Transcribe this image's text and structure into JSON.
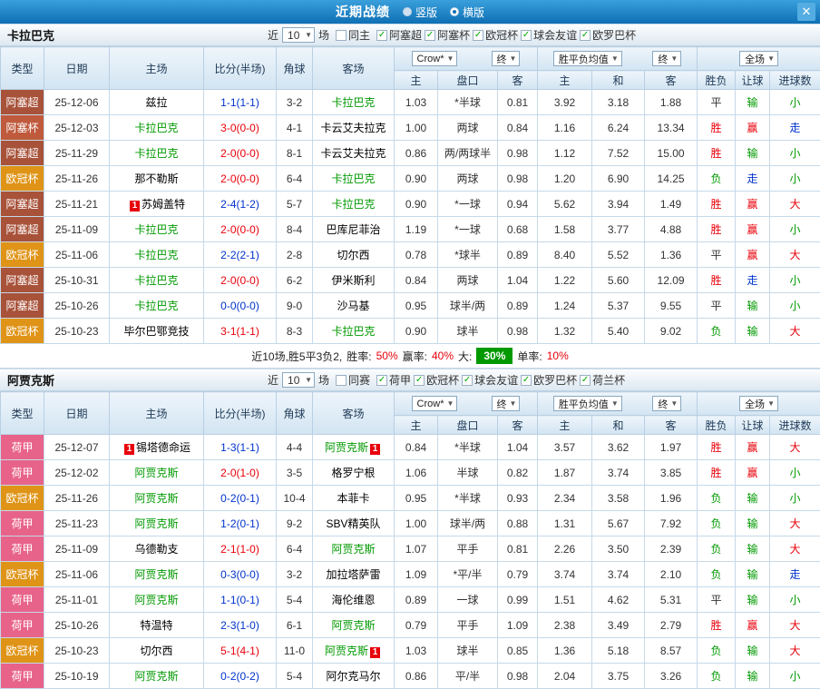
{
  "topbar": {
    "title": "近期战绩",
    "radios": [
      {
        "label": "竖版",
        "selected": false
      },
      {
        "label": "横版",
        "selected": true
      }
    ],
    "close_icon": "✕"
  },
  "palette": {
    "red": "#e8000a",
    "green": "#009900",
    "blue": "#0033cc",
    "black": "#333333",
    "topbar_blue": "#0e6fb4",
    "badge_red": "#e8000a",
    "summary_badge_green": "#009900"
  },
  "league_colors": {
    "阿塞超": "#a8523a",
    "阿塞杯": "#bf5a3d",
    "欧冠杯": "#df9417",
    "荷甲": "#e8638a"
  },
  "columns": {
    "type": "类型",
    "date": "日期",
    "home": "主场",
    "score": "比分(半场)",
    "corner": "角球",
    "away": "客场",
    "asia_home": "主",
    "handicap": "盘口",
    "asia_away": "客",
    "euro_home": "主",
    "euro_draw": "和",
    "euro_away": "客",
    "result": "胜负",
    "cover": "让球",
    "goals": "进球数"
  },
  "sections": [
    {
      "team": "卡拉巴克",
      "filters": {
        "near": "近",
        "count": "10",
        "games": "场",
        "same": "同主",
        "same_checked": false,
        "leagues": [
          {
            "label": "阿塞超",
            "checked": true
          },
          {
            "label": "阿塞杯",
            "checked": true
          },
          {
            "label": "欧冠杯",
            "checked": true
          },
          {
            "label": "球会友谊",
            "checked": true
          },
          {
            "label": "欧罗巴杯",
            "checked": true
          }
        ]
      },
      "dropdowns": {
        "bk": "Crow*",
        "fin1": "终",
        "avg": "胜平负均值",
        "fin2": "终",
        "scope": "全场"
      },
      "rows": [
        {
          "type": "阿塞超",
          "date": "25-12-06",
          "home": "兹拉",
          "home_focal": false,
          "home_badge": "",
          "score": "1-1(1-1)",
          "score_color": "blue",
          "corner": "3-2",
          "away": "卡拉巴克",
          "away_focal": true,
          "away_badge": "",
          "asia": [
            "1.03",
            "*半球",
            "0.81"
          ],
          "euro": [
            "3.92",
            "3.18",
            "1.88"
          ],
          "result": "平",
          "result_color": "black",
          "cover": "输",
          "cover_color": "green",
          "goals": "小",
          "goals_color": "green"
        },
        {
          "type": "阿塞杯",
          "date": "25-12-03",
          "home": "卡拉巴克",
          "home_focal": true,
          "home_badge": "",
          "score": "3-0(0-0)",
          "score_color": "red",
          "corner": "4-1",
          "away": "卡云艾夫拉克",
          "away_focal": false,
          "away_badge": "",
          "asia": [
            "1.00",
            "两球",
            "0.84"
          ],
          "euro": [
            "1.16",
            "6.24",
            "13.34"
          ],
          "result": "胜",
          "result_color": "red",
          "cover": "赢",
          "cover_color": "red",
          "goals": "走",
          "goals_color": "blue"
        },
        {
          "type": "阿塞超",
          "date": "25-11-29",
          "home": "卡拉巴克",
          "home_focal": true,
          "home_badge": "",
          "score": "2-0(0-0)",
          "score_color": "red",
          "corner": "8-1",
          "away": "卡云艾夫拉克",
          "away_focal": false,
          "away_badge": "",
          "asia": [
            "0.86",
            "两/两球半",
            "0.98"
          ],
          "euro": [
            "1.12",
            "7.52",
            "15.00"
          ],
          "result": "胜",
          "result_color": "red",
          "cover": "输",
          "cover_color": "green",
          "goals": "小",
          "goals_color": "green"
        },
        {
          "type": "欧冠杯",
          "date": "25-11-26",
          "home": "那不勒斯",
          "home_focal": false,
          "home_badge": "",
          "score": "2-0(0-0)",
          "score_color": "red",
          "corner": "6-4",
          "away": "卡拉巴克",
          "away_focal": true,
          "away_badge": "",
          "asia": [
            "0.90",
            "两球",
            "0.98"
          ],
          "euro": [
            "1.20",
            "6.90",
            "14.25"
          ],
          "result": "负",
          "result_color": "green",
          "cover": "走",
          "cover_color": "blue",
          "goals": "小",
          "goals_color": "green"
        },
        {
          "type": "阿塞超",
          "date": "25-11-21",
          "home": "苏姆盖特",
          "home_focal": false,
          "home_badge": "1",
          "score": "2-4(1-2)",
          "score_color": "blue",
          "corner": "5-7",
          "away": "卡拉巴克",
          "away_focal": true,
          "away_badge": "",
          "asia": [
            "0.90",
            "*一球",
            "0.94"
          ],
          "euro": [
            "5.62",
            "3.94",
            "1.49"
          ],
          "result": "胜",
          "result_color": "red",
          "cover": "赢",
          "cover_color": "red",
          "goals": "大",
          "goals_color": "red"
        },
        {
          "type": "阿塞超",
          "date": "25-11-09",
          "home": "卡拉巴克",
          "home_focal": true,
          "home_badge": "",
          "score": "2-0(0-0)",
          "score_color": "red",
          "corner": "8-4",
          "away": "巴库尼菲治",
          "away_focal": false,
          "away_badge": "",
          "asia": [
            "1.19",
            "*一球",
            "0.68"
          ],
          "euro": [
            "1.58",
            "3.77",
            "4.88"
          ],
          "result": "胜",
          "result_color": "red",
          "cover": "赢",
          "cover_color": "red",
          "goals": "小",
          "goals_color": "green"
        },
        {
          "type": "欧冠杯",
          "date": "25-11-06",
          "home": "卡拉巴克",
          "home_focal": true,
          "home_badge": "",
          "score": "2-2(2-1)",
          "score_color": "blue",
          "corner": "2-8",
          "away": "切尔西",
          "away_focal": false,
          "away_badge": "",
          "asia": [
            "0.78",
            "*球半",
            "0.89"
          ],
          "euro": [
            "8.40",
            "5.52",
            "1.36"
          ],
          "result": "平",
          "result_color": "black",
          "cover": "赢",
          "cover_color": "red",
          "goals": "大",
          "goals_color": "red"
        },
        {
          "type": "阿塞超",
          "date": "25-10-31",
          "home": "卡拉巴克",
          "home_focal": true,
          "home_badge": "",
          "score": "2-0(0-0)",
          "score_color": "red",
          "corner": "6-2",
          "away": "伊米斯利",
          "away_focal": false,
          "away_badge": "",
          "asia": [
            "0.84",
            "两球",
            "1.04"
          ],
          "euro": [
            "1.22",
            "5.60",
            "12.09"
          ],
          "result": "胜",
          "result_color": "red",
          "cover": "走",
          "cover_color": "blue",
          "goals": "小",
          "goals_color": "green"
        },
        {
          "type": "阿塞超",
          "date": "25-10-26",
          "home": "卡拉巴克",
          "home_focal": true,
          "home_badge": "",
          "score": "0-0(0-0)",
          "score_color": "blue",
          "corner": "9-0",
          "away": "沙马基",
          "away_focal": false,
          "away_badge": "",
          "asia": [
            "0.95",
            "球半/两",
            "0.89"
          ],
          "euro": [
            "1.24",
            "5.37",
            "9.55"
          ],
          "result": "平",
          "result_color": "black",
          "cover": "输",
          "cover_color": "green",
          "goals": "小",
          "goals_color": "green"
        },
        {
          "type": "欧冠杯",
          "date": "25-10-23",
          "home": "毕尔巴鄂竞技",
          "home_focal": false,
          "home_badge": "",
          "score": "3-1(1-1)",
          "score_color": "red",
          "corner": "8-3",
          "away": "卡拉巴克",
          "away_focal": true,
          "away_badge": "",
          "asia": [
            "0.90",
            "球半",
            "0.98"
          ],
          "euro": [
            "1.32",
            "5.40",
            "9.02"
          ],
          "result": "负",
          "result_color": "green",
          "cover": "输",
          "cover_color": "green",
          "goals": "大",
          "goals_color": "red"
        }
      ],
      "summary": {
        "lead": "近10场,胜5平3负2,",
        "win_label": "胜率:",
        "win": "50%",
        "cover_label": "赢率:",
        "cover": "40%",
        "big_label": "大:",
        "big": "30%",
        "odd_label": "单率:",
        "odd": "10%"
      }
    },
    {
      "team": "阿贾克斯",
      "filters": {
        "near": "近",
        "count": "10",
        "games": "场",
        "same": "同赛",
        "same_checked": false,
        "leagues": [
          {
            "label": "荷甲",
            "checked": true
          },
          {
            "label": "欧冠杯",
            "checked": true
          },
          {
            "label": "球会友谊",
            "checked": true
          },
          {
            "label": "欧罗巴杯",
            "checked": true
          },
          {
            "label": "荷兰杯",
            "checked": true
          }
        ]
      },
      "dropdowns": {
        "bk": "Crow*",
        "fin1": "终",
        "avg": "胜平负均值",
        "fin2": "终",
        "scope": "全场"
      },
      "rows": [
        {
          "type": "荷甲",
          "date": "25-12-07",
          "home": "锡塔德命运",
          "home_focal": false,
          "home_badge": "1",
          "score": "1-3(1-1)",
          "score_color": "blue",
          "corner": "4-4",
          "away": "阿贾克斯",
          "away_focal": true,
          "away_badge": "1",
          "asia": [
            "0.84",
            "*半球",
            "1.04"
          ],
          "euro": [
            "3.57",
            "3.62",
            "1.97"
          ],
          "result": "胜",
          "result_color": "red",
          "cover": "赢",
          "cover_color": "red",
          "goals": "大",
          "goals_color": "red"
        },
        {
          "type": "荷甲",
          "date": "25-12-02",
          "home": "阿贾克斯",
          "home_focal": true,
          "home_badge": "",
          "score": "2-0(1-0)",
          "score_color": "red",
          "corner": "3-5",
          "away": "格罗宁根",
          "away_focal": false,
          "away_badge": "",
          "asia": [
            "1.06",
            "半球",
            "0.82"
          ],
          "euro": [
            "1.87",
            "3.74",
            "3.85"
          ],
          "result": "胜",
          "result_color": "red",
          "cover": "赢",
          "cover_color": "red",
          "goals": "小",
          "goals_color": "green"
        },
        {
          "type": "欧冠杯",
          "date": "25-11-26",
          "home": "阿贾克斯",
          "home_focal": true,
          "home_badge": "",
          "score": "0-2(0-1)",
          "score_color": "blue",
          "corner": "10-4",
          "away": "本菲卡",
          "away_focal": false,
          "away_badge": "",
          "asia": [
            "0.95",
            "*半球",
            "0.93"
          ],
          "euro": [
            "2.34",
            "3.58",
            "1.96"
          ],
          "result": "负",
          "result_color": "green",
          "cover": "输",
          "cover_color": "green",
          "goals": "小",
          "goals_color": "green"
        },
        {
          "type": "荷甲",
          "date": "25-11-23",
          "home": "阿贾克斯",
          "home_focal": true,
          "home_badge": "",
          "score": "1-2(0-1)",
          "score_color": "blue",
          "corner": "9-2",
          "away": "SBV精英队",
          "away_focal": false,
          "away_badge": "",
          "asia": [
            "1.00",
            "球半/两",
            "0.88"
          ],
          "euro": [
            "1.31",
            "5.67",
            "7.92"
          ],
          "result": "负",
          "result_color": "green",
          "cover": "输",
          "cover_color": "green",
          "goals": "大",
          "goals_color": "red"
        },
        {
          "type": "荷甲",
          "date": "25-11-09",
          "home": "乌德勒支",
          "home_focal": false,
          "home_badge": "",
          "score": "2-1(1-0)",
          "score_color": "red",
          "corner": "6-4",
          "away": "阿贾克斯",
          "away_focal": true,
          "away_badge": "",
          "asia": [
            "1.07",
            "平手",
            "0.81"
          ],
          "euro": [
            "2.26",
            "3.50",
            "2.39"
          ],
          "result": "负",
          "result_color": "green",
          "cover": "输",
          "cover_color": "green",
          "goals": "大",
          "goals_color": "red"
        },
        {
          "type": "欧冠杯",
          "date": "25-11-06",
          "home": "阿贾克斯",
          "home_focal": true,
          "home_badge": "",
          "score": "0-3(0-0)",
          "score_color": "blue",
          "corner": "3-2",
          "away": "加拉塔萨雷",
          "away_focal": false,
          "away_badge": "",
          "asia": [
            "1.09",
            "*平/半",
            "0.79"
          ],
          "euro": [
            "3.74",
            "3.74",
            "2.10"
          ],
          "result": "负",
          "result_color": "green",
          "cover": "输",
          "cover_color": "green",
          "goals": "走",
          "goals_color": "blue"
        },
        {
          "type": "荷甲",
          "date": "25-11-01",
          "home": "阿贾克斯",
          "home_focal": true,
          "home_badge": "",
          "score": "1-1(0-1)",
          "score_color": "blue",
          "corner": "5-4",
          "away": "海伦维恩",
          "away_focal": false,
          "away_badge": "",
          "asia": [
            "0.89",
            "一球",
            "0.99"
          ],
          "euro": [
            "1.51",
            "4.62",
            "5.31"
          ],
          "result": "平",
          "result_color": "black",
          "cover": "输",
          "cover_color": "green",
          "goals": "小",
          "goals_color": "green"
        },
        {
          "type": "荷甲",
          "date": "25-10-26",
          "home": "特温特",
          "home_focal": false,
          "home_badge": "",
          "score": "2-3(1-0)",
          "score_color": "blue",
          "corner": "6-1",
          "away": "阿贾克斯",
          "away_focal": true,
          "away_badge": "",
          "asia": [
            "0.79",
            "平手",
            "1.09"
          ],
          "euro": [
            "2.38",
            "3.49",
            "2.79"
          ],
          "result": "胜",
          "result_color": "red",
          "cover": "赢",
          "cover_color": "red",
          "goals": "大",
          "goals_color": "red"
        },
        {
          "type": "欧冠杯",
          "date": "25-10-23",
          "home": "切尔西",
          "home_focal": false,
          "home_badge": "",
          "score": "5-1(4-1)",
          "score_color": "red",
          "corner": "11-0",
          "away": "阿贾克斯",
          "away_focal": true,
          "away_badge": "1",
          "asia": [
            "1.03",
            "球半",
            "0.85"
          ],
          "euro": [
            "1.36",
            "5.18",
            "8.57"
          ],
          "result": "负",
          "result_color": "green",
          "cover": "输",
          "cover_color": "green",
          "goals": "大",
          "goals_color": "red"
        },
        {
          "type": "荷甲",
          "date": "25-10-19",
          "home": "阿贾克斯",
          "home_focal": true,
          "home_badge": "",
          "score": "0-2(0-2)",
          "score_color": "blue",
          "corner": "5-4",
          "away": "阿尔克马尔",
          "away_focal": false,
          "away_badge": "",
          "asia": [
            "0.86",
            "平/半",
            "0.98"
          ],
          "euro": [
            "2.04",
            "3.75",
            "3.26"
          ],
          "result": "负",
          "result_color": "green",
          "cover": "输",
          "cover_color": "green",
          "goals": "小",
          "goals_color": "green"
        }
      ]
    }
  ]
}
